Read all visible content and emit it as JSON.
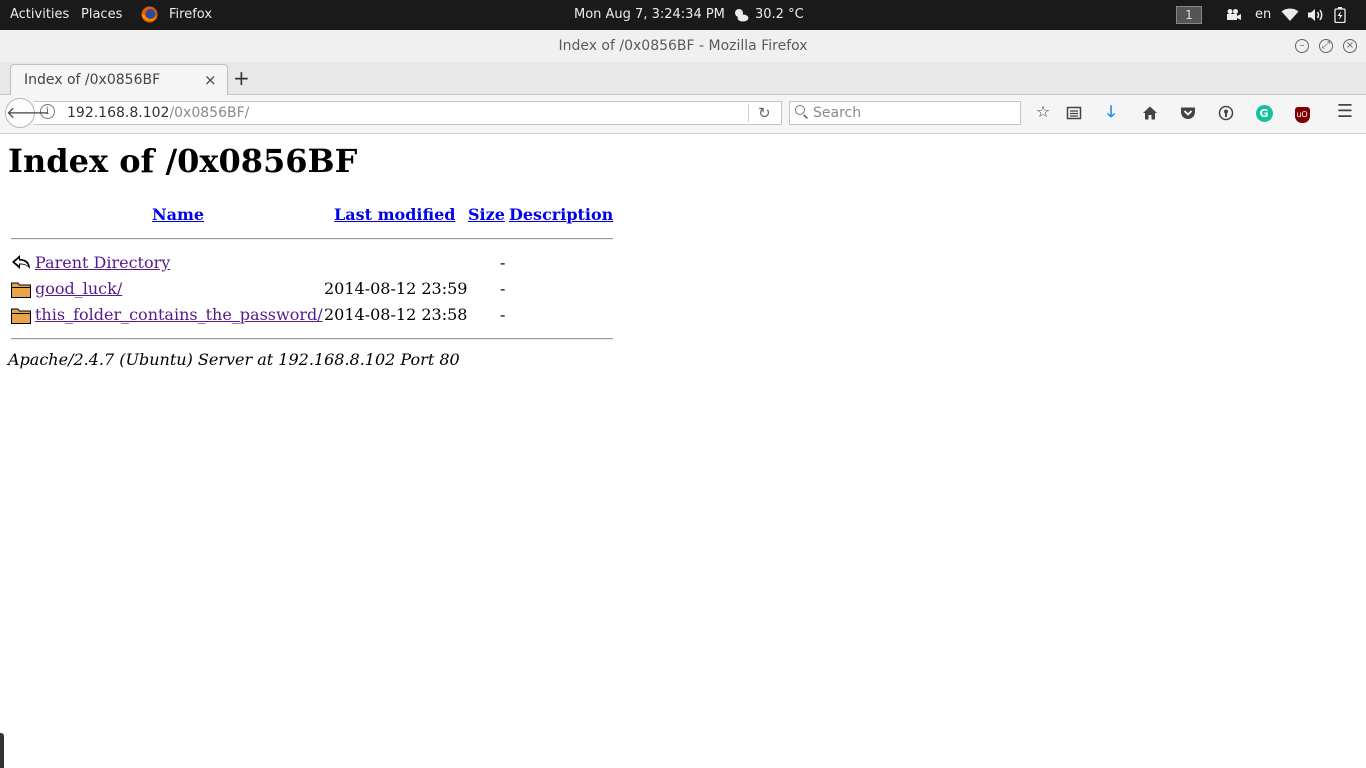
{
  "topbar": {
    "activities": "Activities",
    "places": "Places",
    "app_name": "Firefox",
    "clock": "Mon Aug  7,  3:24:34 PM",
    "temperature": "30.2 °C",
    "workspace": "1",
    "language": "en"
  },
  "window": {
    "title": "Index of /0x0856BF - Mozilla Firefox"
  },
  "tabs": [
    {
      "label": "Index of /0x0856BF",
      "close": "×"
    }
  ],
  "newtab_label": "+",
  "navbar": {
    "url_host": "192.168.8.102",
    "url_path": "/0x0856BF/",
    "search_placeholder": "Search"
  },
  "page": {
    "heading": "Index of /0x0856BF",
    "columns": {
      "name": "Name",
      "last_modified": "Last modified",
      "size": "Size",
      "description": "Description"
    },
    "rows": [
      {
        "icon": "back-arrow-icon",
        "name": "Parent Directory",
        "modified": "",
        "size": "-"
      },
      {
        "icon": "folder-icon",
        "name": "good_luck/",
        "modified": "2014-08-12 23:59",
        "size": "-"
      },
      {
        "icon": "folder-icon",
        "name": "this_folder_contains_the_password/",
        "modified": "2014-08-12 23:58",
        "size": "-"
      }
    ],
    "footer": "Apache/2.4.7 (Ubuntu) Server at 192.168.8.102 Port 80"
  },
  "colors": {
    "link": "#0000ee",
    "visited_link": "#551a8b",
    "topbar_bg": "#1a1a1a",
    "folder": "#e8a44a"
  }
}
